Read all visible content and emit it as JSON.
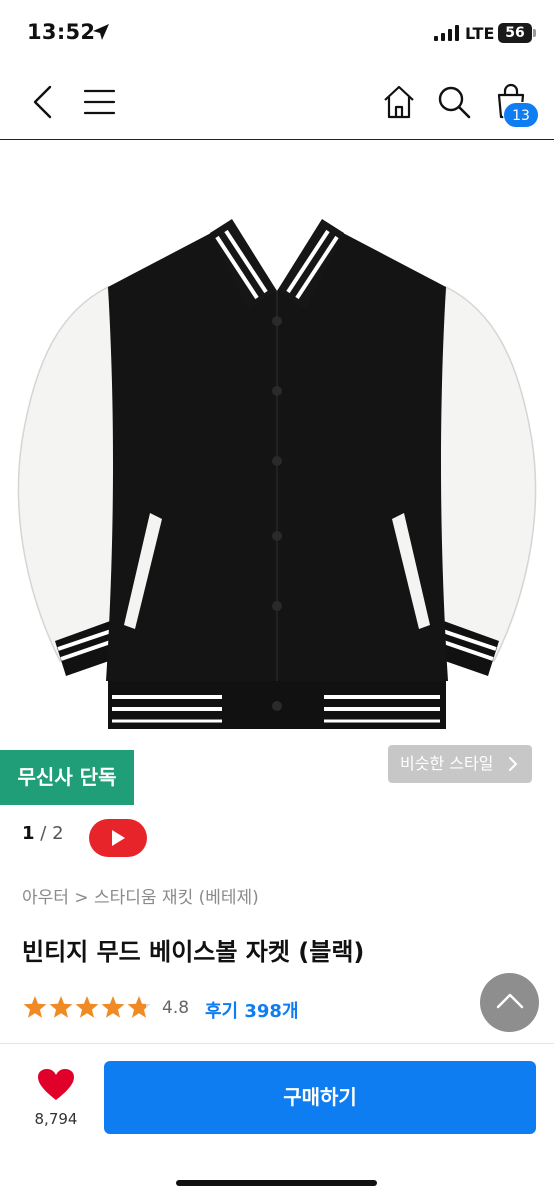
{
  "status_bar": {
    "time": "13:52",
    "network": "LTE",
    "battery": "56",
    "icons": [
      "location-arrow-icon",
      "signal-icon",
      "battery-icon"
    ]
  },
  "nav": {
    "icons": [
      "back-icon",
      "menu-icon",
      "home-icon",
      "search-icon",
      "cart-icon"
    ],
    "cart_count": "13"
  },
  "image": {
    "exclusive_badge": "무신사 단독",
    "similar_style": "비슷한 스타일",
    "page_current": "1",
    "page_separator": "/",
    "page_total": "2",
    "video_icon": "play-icon"
  },
  "product": {
    "breadcrumb": "아우터 > 스타디움 재킷 (베테제)",
    "title": "빈티지 무드 베이스볼 자켓 (블랙)",
    "rating": "4.8",
    "rating_stars": 4.8,
    "reviews": "후기 398개"
  },
  "bottom": {
    "like_count": "8,794",
    "buy_label": "구매하기"
  },
  "colors": {
    "accent": "#0f7df2",
    "badge": "#1f9e77",
    "like": "#e0002a",
    "star": "#f08a24",
    "video": "#e8242b"
  }
}
